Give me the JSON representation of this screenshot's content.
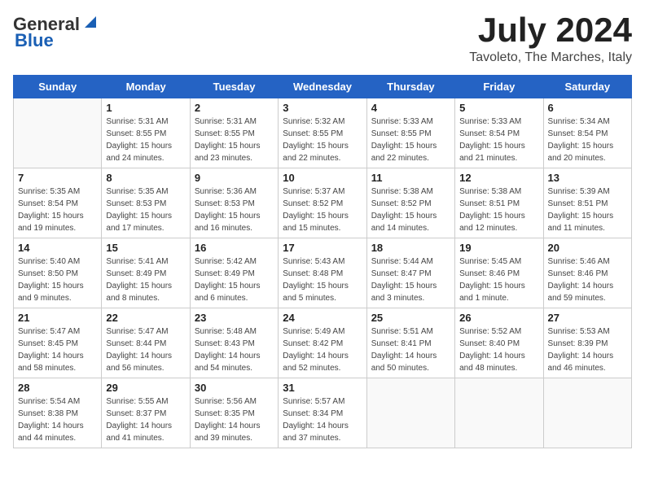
{
  "header": {
    "logo_general": "General",
    "logo_blue": "Blue",
    "month": "July 2024",
    "location": "Tavoleto, The Marches, Italy"
  },
  "days_of_week": [
    "Sunday",
    "Monday",
    "Tuesday",
    "Wednesday",
    "Thursday",
    "Friday",
    "Saturday"
  ],
  "weeks": [
    [
      {
        "day": "",
        "info": ""
      },
      {
        "day": "1",
        "info": "Sunrise: 5:31 AM\nSunset: 8:55 PM\nDaylight: 15 hours\nand 24 minutes."
      },
      {
        "day": "2",
        "info": "Sunrise: 5:31 AM\nSunset: 8:55 PM\nDaylight: 15 hours\nand 23 minutes."
      },
      {
        "day": "3",
        "info": "Sunrise: 5:32 AM\nSunset: 8:55 PM\nDaylight: 15 hours\nand 22 minutes."
      },
      {
        "day": "4",
        "info": "Sunrise: 5:33 AM\nSunset: 8:55 PM\nDaylight: 15 hours\nand 22 minutes."
      },
      {
        "day": "5",
        "info": "Sunrise: 5:33 AM\nSunset: 8:54 PM\nDaylight: 15 hours\nand 21 minutes."
      },
      {
        "day": "6",
        "info": "Sunrise: 5:34 AM\nSunset: 8:54 PM\nDaylight: 15 hours\nand 20 minutes."
      }
    ],
    [
      {
        "day": "7",
        "info": "Sunrise: 5:35 AM\nSunset: 8:54 PM\nDaylight: 15 hours\nand 19 minutes."
      },
      {
        "day": "8",
        "info": "Sunrise: 5:35 AM\nSunset: 8:53 PM\nDaylight: 15 hours\nand 17 minutes."
      },
      {
        "day": "9",
        "info": "Sunrise: 5:36 AM\nSunset: 8:53 PM\nDaylight: 15 hours\nand 16 minutes."
      },
      {
        "day": "10",
        "info": "Sunrise: 5:37 AM\nSunset: 8:52 PM\nDaylight: 15 hours\nand 15 minutes."
      },
      {
        "day": "11",
        "info": "Sunrise: 5:38 AM\nSunset: 8:52 PM\nDaylight: 15 hours\nand 14 minutes."
      },
      {
        "day": "12",
        "info": "Sunrise: 5:38 AM\nSunset: 8:51 PM\nDaylight: 15 hours\nand 12 minutes."
      },
      {
        "day": "13",
        "info": "Sunrise: 5:39 AM\nSunset: 8:51 PM\nDaylight: 15 hours\nand 11 minutes."
      }
    ],
    [
      {
        "day": "14",
        "info": "Sunrise: 5:40 AM\nSunset: 8:50 PM\nDaylight: 15 hours\nand 9 minutes."
      },
      {
        "day": "15",
        "info": "Sunrise: 5:41 AM\nSunset: 8:49 PM\nDaylight: 15 hours\nand 8 minutes."
      },
      {
        "day": "16",
        "info": "Sunrise: 5:42 AM\nSunset: 8:49 PM\nDaylight: 15 hours\nand 6 minutes."
      },
      {
        "day": "17",
        "info": "Sunrise: 5:43 AM\nSunset: 8:48 PM\nDaylight: 15 hours\nand 5 minutes."
      },
      {
        "day": "18",
        "info": "Sunrise: 5:44 AM\nSunset: 8:47 PM\nDaylight: 15 hours\nand 3 minutes."
      },
      {
        "day": "19",
        "info": "Sunrise: 5:45 AM\nSunset: 8:46 PM\nDaylight: 15 hours\nand 1 minute."
      },
      {
        "day": "20",
        "info": "Sunrise: 5:46 AM\nSunset: 8:46 PM\nDaylight: 14 hours\nand 59 minutes."
      }
    ],
    [
      {
        "day": "21",
        "info": "Sunrise: 5:47 AM\nSunset: 8:45 PM\nDaylight: 14 hours\nand 58 minutes."
      },
      {
        "day": "22",
        "info": "Sunrise: 5:47 AM\nSunset: 8:44 PM\nDaylight: 14 hours\nand 56 minutes."
      },
      {
        "day": "23",
        "info": "Sunrise: 5:48 AM\nSunset: 8:43 PM\nDaylight: 14 hours\nand 54 minutes."
      },
      {
        "day": "24",
        "info": "Sunrise: 5:49 AM\nSunset: 8:42 PM\nDaylight: 14 hours\nand 52 minutes."
      },
      {
        "day": "25",
        "info": "Sunrise: 5:51 AM\nSunset: 8:41 PM\nDaylight: 14 hours\nand 50 minutes."
      },
      {
        "day": "26",
        "info": "Sunrise: 5:52 AM\nSunset: 8:40 PM\nDaylight: 14 hours\nand 48 minutes."
      },
      {
        "day": "27",
        "info": "Sunrise: 5:53 AM\nSunset: 8:39 PM\nDaylight: 14 hours\nand 46 minutes."
      }
    ],
    [
      {
        "day": "28",
        "info": "Sunrise: 5:54 AM\nSunset: 8:38 PM\nDaylight: 14 hours\nand 44 minutes."
      },
      {
        "day": "29",
        "info": "Sunrise: 5:55 AM\nSunset: 8:37 PM\nDaylight: 14 hours\nand 41 minutes."
      },
      {
        "day": "30",
        "info": "Sunrise: 5:56 AM\nSunset: 8:35 PM\nDaylight: 14 hours\nand 39 minutes."
      },
      {
        "day": "31",
        "info": "Sunrise: 5:57 AM\nSunset: 8:34 PM\nDaylight: 14 hours\nand 37 minutes."
      },
      {
        "day": "",
        "info": ""
      },
      {
        "day": "",
        "info": ""
      },
      {
        "day": "",
        "info": ""
      }
    ]
  ]
}
